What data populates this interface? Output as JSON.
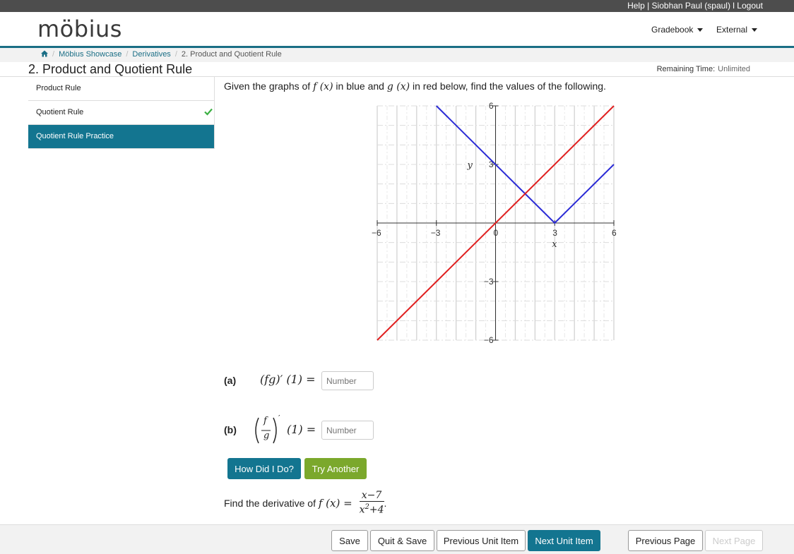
{
  "topbar": {
    "help": "Help",
    "sep1": " | ",
    "user": "Siobhan Paul (spaul)",
    "sep2": " l ",
    "logout": "Logout"
  },
  "header": {
    "logo": "möbius",
    "gradebook": "Gradebook",
    "external": "External"
  },
  "breadcrumb": {
    "items": [
      "Möbius Showcase",
      "Derivatives"
    ],
    "current": "2. Product and Quotient Rule"
  },
  "page": {
    "title": "2. Product and Quotient Rule",
    "remaining_label": "Remaining Time:",
    "remaining_value": "Unlimited"
  },
  "sidebar": {
    "items": [
      {
        "label": "Product Rule",
        "checked": false,
        "active": false
      },
      {
        "label": "Quotient Rule",
        "checked": true,
        "active": false
      },
      {
        "label": "Quotient Rule Practice",
        "checked": false,
        "active": true
      }
    ]
  },
  "question": {
    "prompt_a": "Given the graphs of ",
    "prompt_f": "f (x)",
    "prompt_b": " in blue and ",
    "prompt_g": "g (x)",
    "prompt_c": " in red below, find the values of the following.",
    "part_a_label": "(a)",
    "part_a_expr": "(fg)′ (1) =",
    "part_b_label": "(b)",
    "part_b_expr": "(1) =",
    "part_b_num": "f",
    "part_b_den": "g",
    "input_placeholder": "Number",
    "how_button": "How Did I Do?",
    "try_button": "Try Another",
    "derivative_text": "Find the derivative of ",
    "derivative_f": "f (x) =",
    "derivative_num": "x−7",
    "derivative_den": "x",
    "derivative_den_tail": "+4",
    "derivative_den_exp": "2"
  },
  "chart_data": {
    "type": "line",
    "xlabel": "x",
    "ylabel": "y",
    "xlim": [
      -6,
      6
    ],
    "ylim": [
      -6,
      6
    ],
    "xticks": [
      -6,
      -3,
      0,
      3,
      6
    ],
    "yticks": [
      -6,
      -3,
      3,
      6
    ],
    "grid": true,
    "series": [
      {
        "color": "#2b2bd6",
        "points": [
          [
            -3,
            6
          ],
          [
            3,
            0
          ],
          [
            6,
            3
          ]
        ]
      },
      {
        "color": "#e02020",
        "points": [
          [
            -6,
            -6
          ],
          [
            6,
            6
          ]
        ]
      }
    ]
  },
  "footer": {
    "save": "Save",
    "quit_save": "Quit & Save",
    "prev_unit": "Previous Unit Item",
    "next_unit": "Next Unit Item",
    "prev_page": "Previous Page",
    "next_page": "Next Page"
  }
}
